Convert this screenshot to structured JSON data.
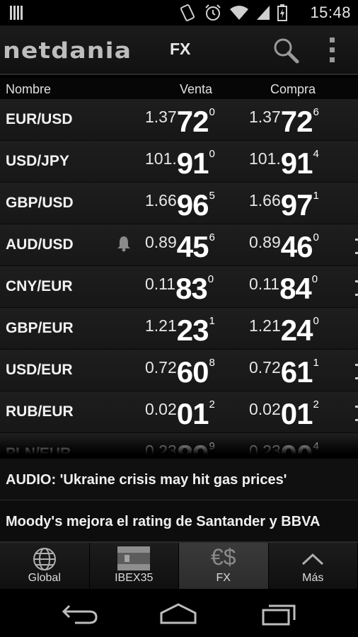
{
  "status_bar": {
    "time": "15:48"
  },
  "action_bar": {
    "logo": "netdania",
    "title": "FX"
  },
  "table": {
    "headers": {
      "name": "Nombre",
      "sell": "Venta",
      "buy": "Compra"
    },
    "rows": [
      {
        "pair": "EUR/USD",
        "sell": {
          "pre": "1.37",
          "big": "72",
          "sup": "0"
        },
        "buy": {
          "pre": "1.37",
          "big": "72",
          "sup": "6"
        },
        "alert": false
      },
      {
        "pair": "USD/JPY",
        "sell": {
          "pre": "101.",
          "big": "91",
          "sup": "0"
        },
        "buy": {
          "pre": "101.",
          "big": "91",
          "sup": "4"
        },
        "alert": false
      },
      {
        "pair": "GBP/USD",
        "sell": {
          "pre": "1.66",
          "big": "96",
          "sup": "5"
        },
        "buy": {
          "pre": "1.66",
          "big": "97",
          "sup": "1"
        },
        "alert": false
      },
      {
        "pair": "AUD/USD",
        "sell": {
          "pre": "0.89",
          "big": "45",
          "sup": "6"
        },
        "buy": {
          "pre": "0.89",
          "big": "46",
          "sup": "0"
        },
        "alert": true
      },
      {
        "pair": "CNY/EUR",
        "sell": {
          "pre": "0.11",
          "big": "83",
          "sup": "0"
        },
        "buy": {
          "pre": "0.11",
          "big": "84",
          "sup": "0"
        },
        "alert": false
      },
      {
        "pair": "GBP/EUR",
        "sell": {
          "pre": "1.21",
          "big": "23",
          "sup": "1"
        },
        "buy": {
          "pre": "1.21",
          "big": "24",
          "sup": "0"
        },
        "alert": false
      },
      {
        "pair": "USD/EUR",
        "sell": {
          "pre": "0.72",
          "big": "60",
          "sup": "8"
        },
        "buy": {
          "pre": "0.72",
          "big": "61",
          "sup": "1"
        },
        "alert": false
      },
      {
        "pair": "RUB/EUR",
        "sell": {
          "pre": "0.02",
          "big": "01",
          "sup": "2"
        },
        "buy": {
          "pre": "0.02",
          "big": "01",
          "sup": "2"
        },
        "alert": false
      },
      {
        "pair": "PLN/EUR",
        "sell": {
          "pre": "0.23",
          "big": "89",
          "sup": "9"
        },
        "buy": {
          "pre": "0.23",
          "big": "90",
          "sup": "4"
        },
        "alert": false
      }
    ]
  },
  "news": [
    "AUDIO: 'Ukraine crisis may hit gas prices'",
    "Moody's mejora el rating de Santander y BBVA"
  ],
  "tabs": [
    {
      "label": "Global",
      "icon": "globe-icon",
      "active": false
    },
    {
      "label": "IBEX35",
      "icon": "spain-flag-icon",
      "active": false
    },
    {
      "label": "FX",
      "icon": "currency-icon",
      "active": true
    },
    {
      "label": "Más",
      "icon": "chevron-up-icon",
      "active": false
    }
  ],
  "fx_icon_text": "€$",
  "colors": {
    "background": "#000000",
    "row": "#1c1c1c",
    "active_tab": "#333333",
    "text": "#ffffff"
  }
}
